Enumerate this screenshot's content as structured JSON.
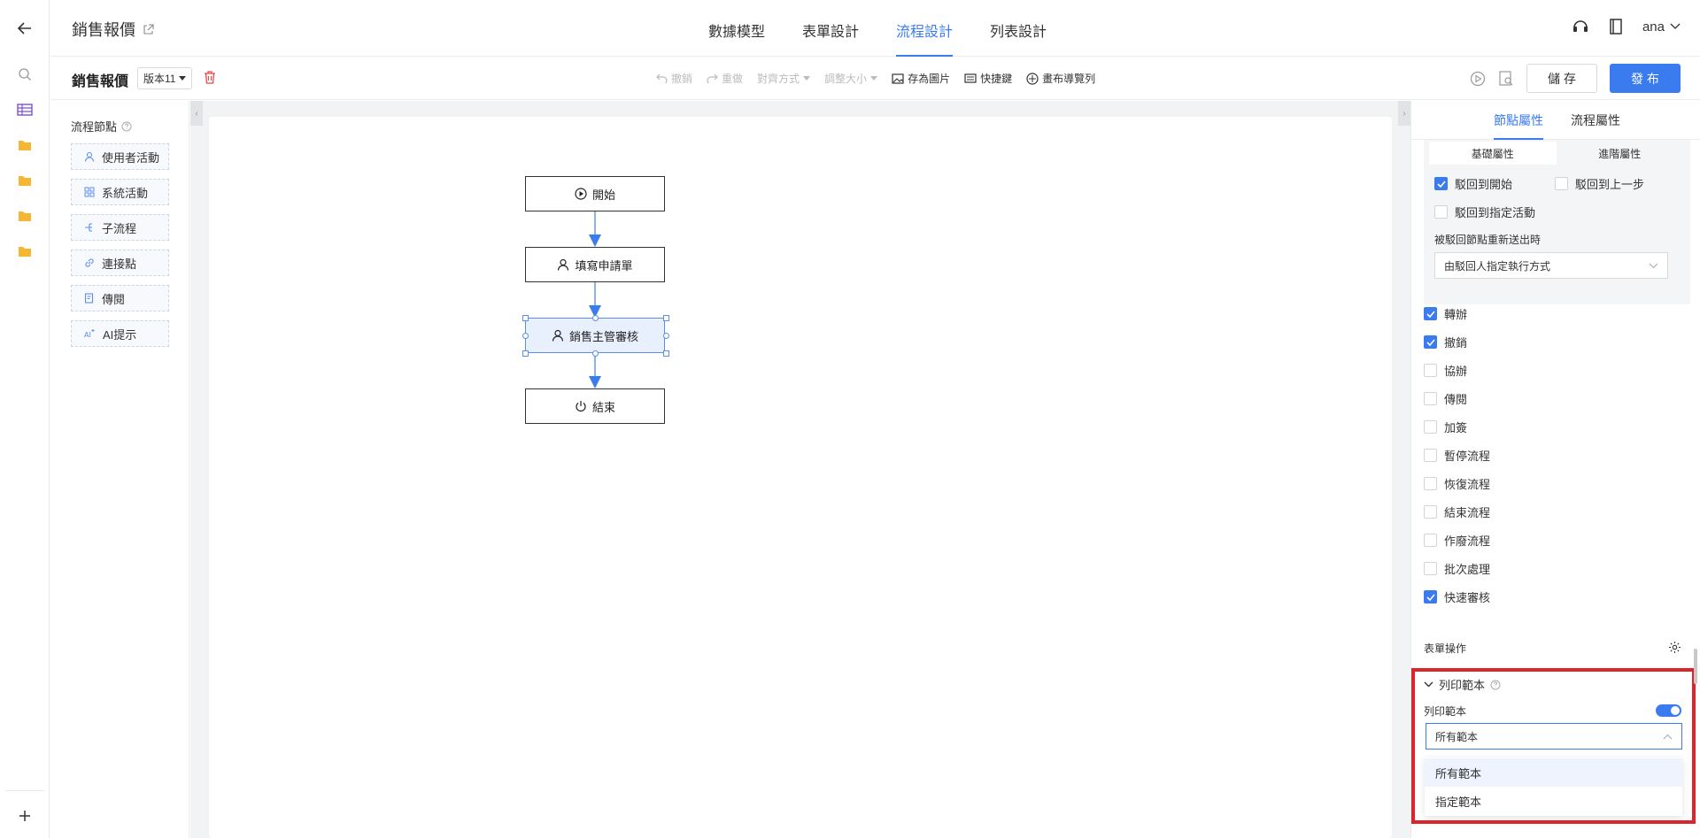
{
  "app": {
    "title": "銷售報價",
    "user": "ana"
  },
  "nav": {
    "tabs": [
      "數據模型",
      "表單設計",
      "流程設計",
      "列表設計"
    ],
    "active": 2
  },
  "toolbar": {
    "title": "銷售報價",
    "version": "版本11",
    "undo": "撤銷",
    "redo": "重做",
    "align": "對齊方式",
    "resize": "調整大小",
    "save_image": "存為圖片",
    "shortcuts": "快捷鍵",
    "canvas_nav": "畫布導覽列",
    "save": "儲 存",
    "publish": "發 布"
  },
  "left_panel": {
    "title": "流程節點",
    "items": [
      "使用者活動",
      "系統活動",
      "子流程",
      "連接點",
      "傳閱",
      "AI提示"
    ]
  },
  "flow": {
    "nodes": [
      {
        "label": "開始",
        "icon": "play-circle-icon"
      },
      {
        "label": "填寫申請單",
        "icon": "user-icon"
      },
      {
        "label": "銷售主管審核",
        "icon": "user-icon",
        "selected": true
      },
      {
        "label": "結束",
        "icon": "power-icon"
      }
    ]
  },
  "right_panel": {
    "tabs": [
      "節點屬性",
      "流程屬性"
    ],
    "active_tab": 0,
    "sub_tabs": [
      "基礎屬性",
      "進階屬性"
    ],
    "reject": {
      "options": [
        {
          "label": "駁回到開始",
          "checked": true
        },
        {
          "label": "駁回到上一步",
          "checked": false
        },
        {
          "label": "駁回到指定活動",
          "checked": false
        }
      ],
      "resubmit_label": "被駁回節點重新送出時",
      "resubmit_value": "由駁回人指定執行方式"
    },
    "operations": [
      {
        "label": "轉辦",
        "checked": true
      },
      {
        "label": "撤銷",
        "checked": true
      },
      {
        "label": "協辦",
        "checked": false
      },
      {
        "label": "傳閱",
        "checked": false
      },
      {
        "label": "加簽",
        "checked": false
      },
      {
        "label": "暫停流程",
        "checked": false
      },
      {
        "label": "恢復流程",
        "checked": false
      },
      {
        "label": "結束流程",
        "checked": false
      },
      {
        "label": "作廢流程",
        "checked": false
      },
      {
        "label": "批次處理",
        "checked": false
      },
      {
        "label": "快速審核",
        "checked": true
      }
    ],
    "form_ops_label": "表單操作",
    "print": {
      "section_title": "列印範本",
      "toggle_label": "列印範本",
      "toggle_on": true,
      "select_value": "所有範本",
      "options": [
        "所有範本",
        "指定範本"
      ]
    }
  },
  "colors": {
    "accent": "#3a7bf0",
    "highlight": "#d9252b"
  }
}
